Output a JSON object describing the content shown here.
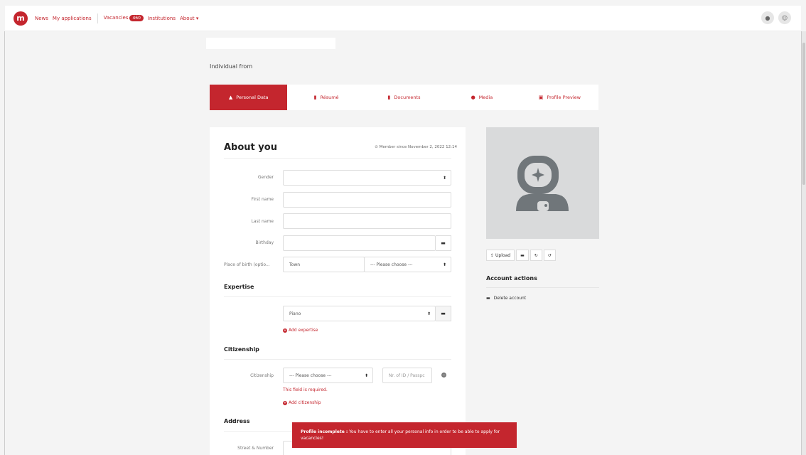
{
  "nav": {
    "logo": "m",
    "news": "News",
    "my_applications": "My applications",
    "vacancies": "Vacancies",
    "vacancies_count": "460",
    "institutions": "Institutions",
    "about": "About ▾"
  },
  "header": {
    "individual": "Individual from"
  },
  "tabs": [
    {
      "label": "Personal Data",
      "icon": "bell-icon",
      "glyph": "▲"
    },
    {
      "label": "Résumé",
      "icon": "file-icon",
      "glyph": "▮"
    },
    {
      "label": "Documents",
      "icon": "files-icon",
      "glyph": "▮"
    },
    {
      "label": "Media",
      "icon": "camera-icon",
      "glyph": "●"
    },
    {
      "label": "Profile Preview",
      "icon": "id-icon",
      "glyph": "▣"
    }
  ],
  "form": {
    "title": "About you",
    "member_since": "⊙ Member since November 2, 2022 12:14",
    "gender_label": "Gender",
    "first_name_label": "First name",
    "last_name_label": "Last name",
    "birthday_label": "Birthday",
    "place_of_birth_label": "Place of birth (optio...",
    "town_placeholder": "Town",
    "please_choose": "--- Please choose ---",
    "expertise_title": "Expertise",
    "expertise_value": "Piano",
    "add_expertise": "Add expertise",
    "citizenship_title": "Citizenship",
    "citizenship_label": "Citizenship",
    "id_placeholder": "Nr. of ID / Passpc",
    "field_required": "This field is required.",
    "add_citizenship": "Add citizenship",
    "address_title": "Address",
    "street_label": "Street & Number"
  },
  "avatar": {
    "upload": "Upload",
    "account_actions": "Account actions",
    "delete_account": "Delete account"
  },
  "toast": {
    "title": "Profile incomplete :",
    "message": " You have to enter all your personal info in order to be able to apply for vacancies!"
  },
  "colors": {
    "accent": "#c4262e",
    "avatar_bg": "#d9dadb",
    "avatar_fg": "#70767a"
  }
}
